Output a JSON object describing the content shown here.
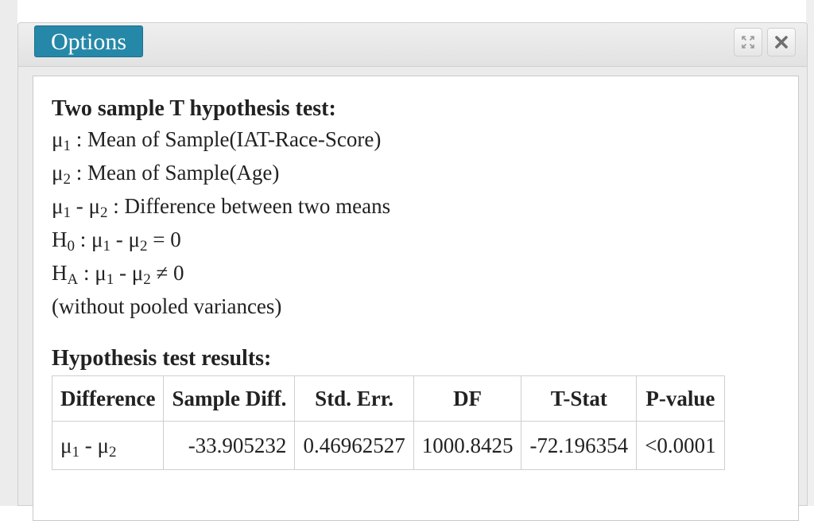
{
  "window": {
    "options_label": "Options",
    "icons": [
      "expand-icon",
      "close-icon"
    ]
  },
  "report": {
    "title": "Two sample T hypothesis test:",
    "lines": [
      {
        "sym": "μ",
        "sub": "1",
        "text": " : Mean of Sample(IAT-Race-Score)"
      },
      {
        "sym": "μ",
        "sub": "2",
        "text": " : Mean of Sample(Age)"
      }
    ],
    "diff_line": {
      "a": "μ",
      "a_sub": "1",
      "sep": " - ",
      "b": "μ",
      "b_sub": "2",
      "text": " : Difference between two means"
    },
    "h0": {
      "H": "H",
      "H_sub": "0",
      "rest_pre": " : ",
      "a": "μ",
      "a_sub": "1",
      "sep": " - ",
      "b": "μ",
      "b_sub": "2",
      "rel": " = 0"
    },
    "ha": {
      "H": "H",
      "H_sub": "A",
      "rest_pre": " : ",
      "a": "μ",
      "a_sub": "1",
      "sep": " - ",
      "b": "μ",
      "b_sub": "2",
      "rel": " ≠ 0"
    },
    "note": "(without pooled variances)"
  },
  "results": {
    "title": "Hypothesis test results:",
    "columns": [
      "Difference",
      "Sample Diff.",
      "Std. Err.",
      "DF",
      "T-Stat",
      "P-value"
    ],
    "row": {
      "difference": {
        "a": "μ",
        "a_sub": "1",
        "sep": " - ",
        "b": "μ",
        "b_sub": "2"
      },
      "sample_diff": "-33.905232",
      "std_err": "0.46962527",
      "df": "1000.8425",
      "t_stat": "-72.196354",
      "p_value": "<0.0001"
    }
  }
}
